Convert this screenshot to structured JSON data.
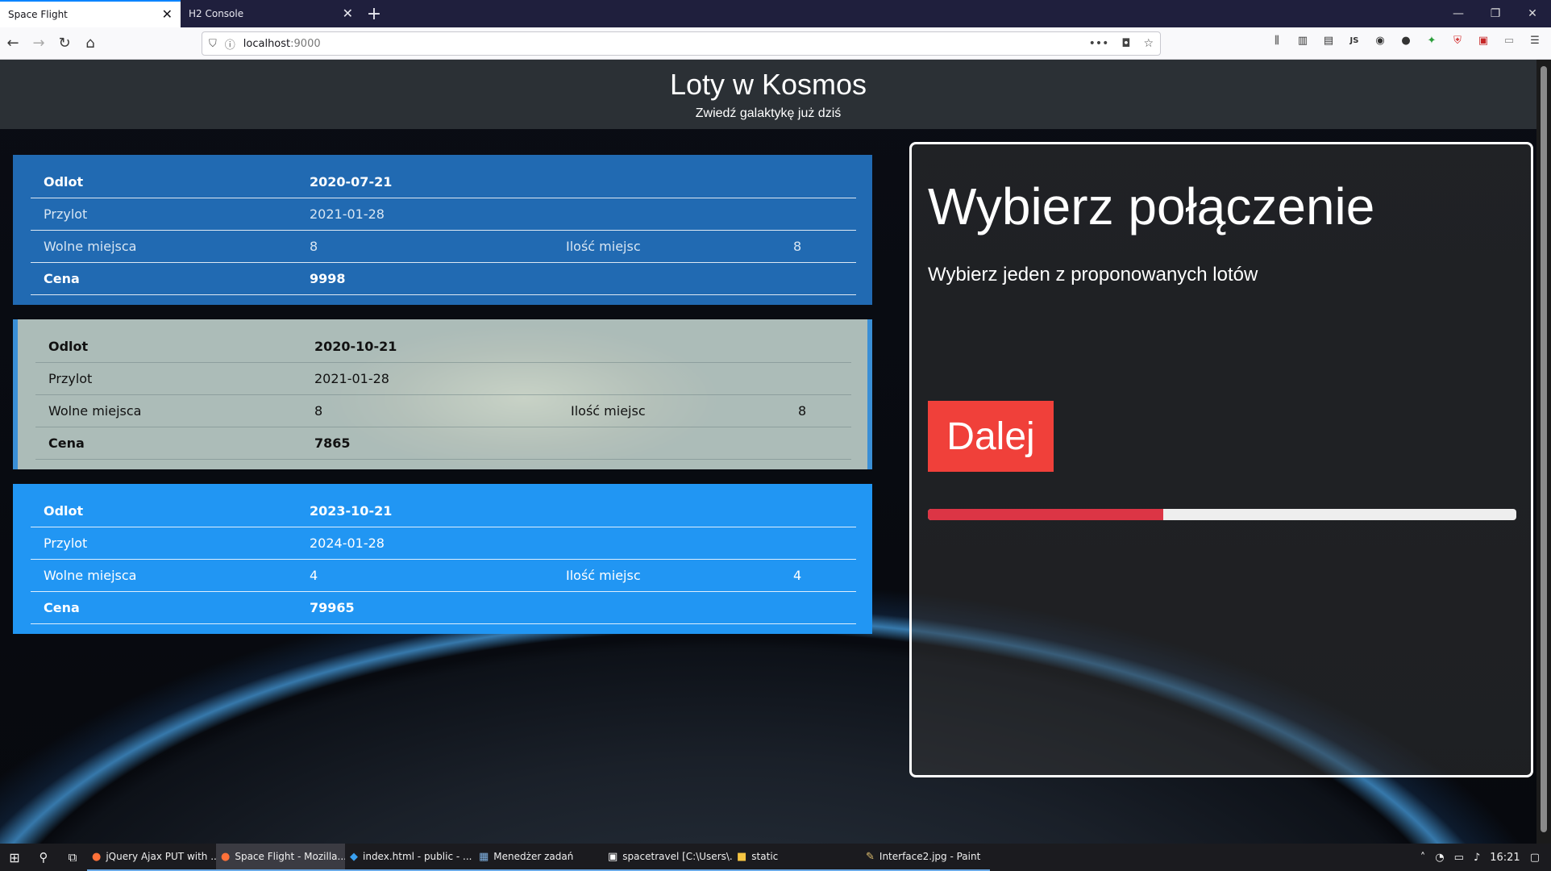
{
  "browser": {
    "tabs": [
      {
        "title": "Space Flight",
        "active": true
      },
      {
        "title": "H2 Console",
        "active": false
      }
    ],
    "url_host": "localhost",
    "url_port": ":9000"
  },
  "header": {
    "title": "Loty w Kosmos",
    "subtitle": "Zwiedź galaktykę już dziś"
  },
  "flights": [
    {
      "odlot_label": "Odlot",
      "odlot": "2020-07-21",
      "przylot_label": "Przylot",
      "przylot": "2021-01-28",
      "wolne_label": "Wolne miejsca",
      "wolne": "8",
      "ilosc_label": "Ilość miejsc",
      "ilosc": "8",
      "cena_label": "Cena",
      "cena": "9998"
    },
    {
      "odlot_label": "Odlot",
      "odlot": "2020-10-21",
      "przylot_label": "Przylot",
      "przylot": "2021-01-28",
      "wolne_label": "Wolne miejsca",
      "wolne": "8",
      "ilosc_label": "Ilość miejsc",
      "ilosc": "8",
      "cena_label": "Cena",
      "cena": "7865"
    },
    {
      "odlot_label": "Odlot",
      "odlot": "2023-10-21",
      "przylot_label": "Przylot",
      "przylot": "2024-01-28",
      "wolne_label": "Wolne miejsca",
      "wolne": "4",
      "ilosc_label": "Ilość miejsc",
      "ilosc": "4",
      "cena_label": "Cena",
      "cena": "79965"
    }
  ],
  "panel": {
    "title": "Wybierz połączenie",
    "text": "Wybierz jeden z proponowanych lotów",
    "button": "Dalej",
    "progress_fraction": 0.4
  },
  "taskbar": {
    "apps": [
      {
        "label": "jQuery Ajax PUT with ...",
        "icon": "firefox-icon"
      },
      {
        "label": "Space Flight - Mozilla...",
        "icon": "firefox-icon",
        "active": true
      },
      {
        "label": "index.html - public - ...",
        "icon": "vscode-icon"
      },
      {
        "label": "Menedżer zadań",
        "icon": "task-manager-icon"
      },
      {
        "label": "spacetravel [C:\\Users\\...",
        "icon": "intellij-icon"
      },
      {
        "label": "static",
        "icon": "folder-icon"
      },
      {
        "label": "Interface2.jpg - Paint",
        "icon": "paint-icon"
      }
    ],
    "clock": "16:21"
  },
  "colors": {
    "card1": "#2478c8",
    "card3": "#2196f3",
    "button": "#f0403a",
    "progress": "#dc3545"
  }
}
